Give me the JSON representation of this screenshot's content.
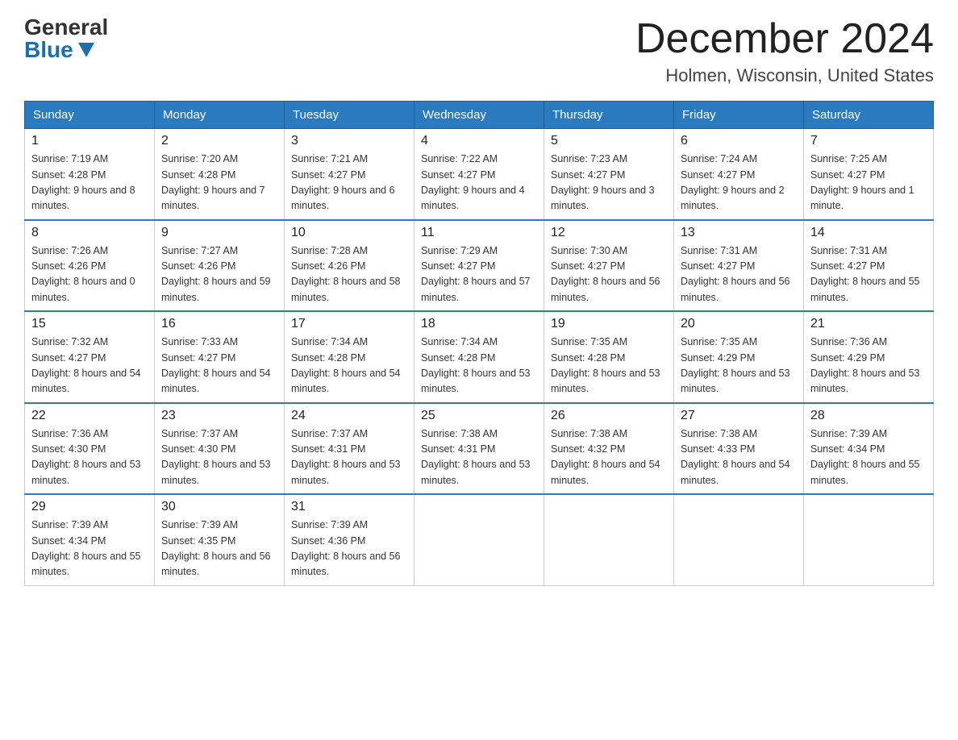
{
  "header": {
    "logo_general": "General",
    "logo_blue": "Blue",
    "month_year": "December 2024",
    "location": "Holmen, Wisconsin, United States"
  },
  "days_of_week": [
    "Sunday",
    "Monday",
    "Tuesday",
    "Wednesday",
    "Thursday",
    "Friday",
    "Saturday"
  ],
  "weeks": [
    [
      {
        "day": "1",
        "sunrise": "7:19 AM",
        "sunset": "4:28 PM",
        "daylight": "9 hours and 8 minutes."
      },
      {
        "day": "2",
        "sunrise": "7:20 AM",
        "sunset": "4:28 PM",
        "daylight": "9 hours and 7 minutes."
      },
      {
        "day": "3",
        "sunrise": "7:21 AM",
        "sunset": "4:27 PM",
        "daylight": "9 hours and 6 minutes."
      },
      {
        "day": "4",
        "sunrise": "7:22 AM",
        "sunset": "4:27 PM",
        "daylight": "9 hours and 4 minutes."
      },
      {
        "day": "5",
        "sunrise": "7:23 AM",
        "sunset": "4:27 PM",
        "daylight": "9 hours and 3 minutes."
      },
      {
        "day": "6",
        "sunrise": "7:24 AM",
        "sunset": "4:27 PM",
        "daylight": "9 hours and 2 minutes."
      },
      {
        "day": "7",
        "sunrise": "7:25 AM",
        "sunset": "4:27 PM",
        "daylight": "9 hours and 1 minute."
      }
    ],
    [
      {
        "day": "8",
        "sunrise": "7:26 AM",
        "sunset": "4:26 PM",
        "daylight": "8 hours and 0 minutes."
      },
      {
        "day": "9",
        "sunrise": "7:27 AM",
        "sunset": "4:26 PM",
        "daylight": "8 hours and 59 minutes."
      },
      {
        "day": "10",
        "sunrise": "7:28 AM",
        "sunset": "4:26 PM",
        "daylight": "8 hours and 58 minutes."
      },
      {
        "day": "11",
        "sunrise": "7:29 AM",
        "sunset": "4:27 PM",
        "daylight": "8 hours and 57 minutes."
      },
      {
        "day": "12",
        "sunrise": "7:30 AM",
        "sunset": "4:27 PM",
        "daylight": "8 hours and 56 minutes."
      },
      {
        "day": "13",
        "sunrise": "7:31 AM",
        "sunset": "4:27 PM",
        "daylight": "8 hours and 56 minutes."
      },
      {
        "day": "14",
        "sunrise": "7:31 AM",
        "sunset": "4:27 PM",
        "daylight": "8 hours and 55 minutes."
      }
    ],
    [
      {
        "day": "15",
        "sunrise": "7:32 AM",
        "sunset": "4:27 PM",
        "daylight": "8 hours and 54 minutes."
      },
      {
        "day": "16",
        "sunrise": "7:33 AM",
        "sunset": "4:27 PM",
        "daylight": "8 hours and 54 minutes."
      },
      {
        "day": "17",
        "sunrise": "7:34 AM",
        "sunset": "4:28 PM",
        "daylight": "8 hours and 54 minutes."
      },
      {
        "day": "18",
        "sunrise": "7:34 AM",
        "sunset": "4:28 PM",
        "daylight": "8 hours and 53 minutes."
      },
      {
        "day": "19",
        "sunrise": "7:35 AM",
        "sunset": "4:28 PM",
        "daylight": "8 hours and 53 minutes."
      },
      {
        "day": "20",
        "sunrise": "7:35 AM",
        "sunset": "4:29 PM",
        "daylight": "8 hours and 53 minutes."
      },
      {
        "day": "21",
        "sunrise": "7:36 AM",
        "sunset": "4:29 PM",
        "daylight": "8 hours and 53 minutes."
      }
    ],
    [
      {
        "day": "22",
        "sunrise": "7:36 AM",
        "sunset": "4:30 PM",
        "daylight": "8 hours and 53 minutes."
      },
      {
        "day": "23",
        "sunrise": "7:37 AM",
        "sunset": "4:30 PM",
        "daylight": "8 hours and 53 minutes."
      },
      {
        "day": "24",
        "sunrise": "7:37 AM",
        "sunset": "4:31 PM",
        "daylight": "8 hours and 53 minutes."
      },
      {
        "day": "25",
        "sunrise": "7:38 AM",
        "sunset": "4:31 PM",
        "daylight": "8 hours and 53 minutes."
      },
      {
        "day": "26",
        "sunrise": "7:38 AM",
        "sunset": "4:32 PM",
        "daylight": "8 hours and 54 minutes."
      },
      {
        "day": "27",
        "sunrise": "7:38 AM",
        "sunset": "4:33 PM",
        "daylight": "8 hours and 54 minutes."
      },
      {
        "day": "28",
        "sunrise": "7:39 AM",
        "sunset": "4:34 PM",
        "daylight": "8 hours and 55 minutes."
      }
    ],
    [
      {
        "day": "29",
        "sunrise": "7:39 AM",
        "sunset": "4:34 PM",
        "daylight": "8 hours and 55 minutes."
      },
      {
        "day": "30",
        "sunrise": "7:39 AM",
        "sunset": "4:35 PM",
        "daylight": "8 hours and 56 minutes."
      },
      {
        "day": "31",
        "sunrise": "7:39 AM",
        "sunset": "4:36 PM",
        "daylight": "8 hours and 56 minutes."
      },
      null,
      null,
      null,
      null
    ]
  ]
}
